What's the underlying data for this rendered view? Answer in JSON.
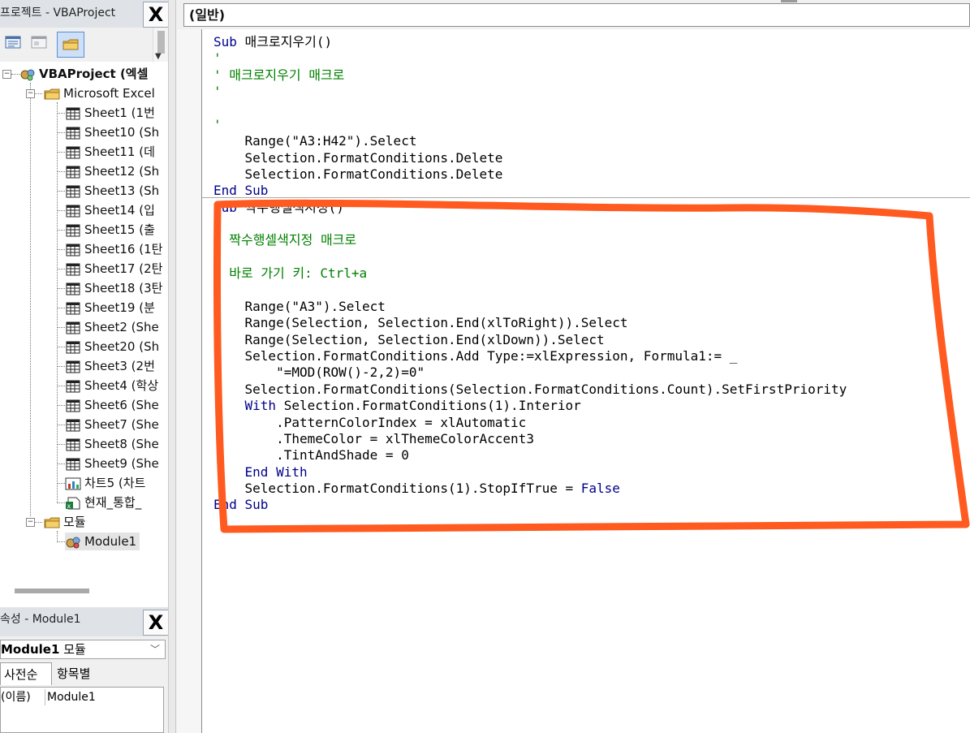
{
  "project": {
    "title": "프로젝트 - VBAProject",
    "close_label": "X",
    "toolbar": [
      "view-code-icon",
      "view-object-icon",
      "toggle-folders-icon"
    ],
    "tree": {
      "root": "VBAProject (엑셀",
      "objects_folder": "Microsoft Excel",
      "sheets": [
        "Sheet1 (1번",
        "Sheet10 (Sh",
        "Sheet11 (데",
        "Sheet12 (Sh",
        "Sheet13 (Sh",
        "Sheet14 (입",
        "Sheet15 (출",
        "Sheet16 (1탄",
        "Sheet17 (2탄",
        "Sheet18 (3탄",
        "Sheet19 (분",
        "Sheet2 (She",
        "Sheet20 (Sh",
        "Sheet3 (2번",
        "Sheet4 (학상",
        "Sheet6 (She",
        "Sheet7 (She",
        "Sheet8 (She",
        "Sheet9 (She"
      ],
      "chart": "차트5 (차트",
      "workbook": "현재_통합_",
      "modules_folder": "모듈",
      "module": "Module1"
    }
  },
  "properties": {
    "title": "속성 - Module1",
    "close_label": "X",
    "object_name": "Module1",
    "object_type": "모듈",
    "tabs": [
      "사전순",
      "항목별"
    ],
    "rows": [
      {
        "name": "(이름)",
        "value": "Module1"
      }
    ]
  },
  "code": {
    "object_combo": "(일반)",
    "lines": [
      [
        {
          "t": "Sub ",
          "k": "kw"
        },
        {
          "t": "매크로지우기()"
        }
      ],
      [
        {
          "t": "'",
          "k": "cm"
        }
      ],
      [
        {
          "t": "' 매크로지우기 매크로",
          "k": "cm"
        }
      ],
      [
        {
          "t": "'",
          "k": "cm"
        }
      ],
      [
        {
          "t": ""
        }
      ],
      [
        {
          "t": "'",
          "k": "cm"
        }
      ],
      [
        {
          "t": "    Range(\"A3:H42\").Select"
        }
      ],
      [
        {
          "t": "    Selection.FormatConditions.Delete"
        }
      ],
      [
        {
          "t": "    Selection.FormatConditions.Delete"
        }
      ],
      [
        {
          "t": "End Sub",
          "k": "kw"
        }
      ],
      [
        {
          "t": "Sub ",
          "k": "kw"
        },
        {
          "t": "짝수행셀색지정()"
        }
      ],
      [
        {
          "t": "'",
          "k": "cm"
        }
      ],
      [
        {
          "t": "' 짝수행셀색지정 매크로",
          "k": "cm"
        }
      ],
      [
        {
          "t": "'",
          "k": "cm"
        }
      ],
      [
        {
          "t": "' 바로 가기 키: Ctrl+a",
          "k": "cm"
        }
      ],
      [
        {
          "t": "'",
          "k": "cm"
        }
      ],
      [
        {
          "t": "    Range(\"A3\").Select"
        }
      ],
      [
        {
          "t": "    Range(Selection, Selection.End(xlToRight)).Select"
        }
      ],
      [
        {
          "t": "    Range(Selection, Selection.End(xlDown)).Select"
        }
      ],
      [
        {
          "t": "    Selection.FormatConditions.Add Type:=xlExpression, Formula1:= _"
        }
      ],
      [
        {
          "t": "        \"=MOD(ROW()-2,2)=0\""
        }
      ],
      [
        {
          "t": "    Selection.FormatConditions(Selection.FormatConditions.Count).SetFirstPriority"
        }
      ],
      [
        {
          "t": "    With ",
          "k": "kw"
        },
        {
          "t": "Selection.FormatConditions(1).Interior"
        }
      ],
      [
        {
          "t": "        .PatternColorIndex = xlAutomatic"
        }
      ],
      [
        {
          "t": "        .ThemeColor = xlThemeColorAccent3"
        }
      ],
      [
        {
          "t": "        .TintAndShade = 0"
        }
      ],
      [
        {
          "t": "    End With",
          "k": "kw"
        }
      ],
      [
        {
          "t": "    Selection.FormatConditions(1).StopIfTrue = "
        },
        {
          "t": "False",
          "k": "kw"
        }
      ],
      [
        {
          "t": "End Sub",
          "k": "kw"
        }
      ]
    ]
  },
  "colors": {
    "keyword": "#00008b",
    "comment": "#008000",
    "annotation": "#ff5a1f"
  }
}
